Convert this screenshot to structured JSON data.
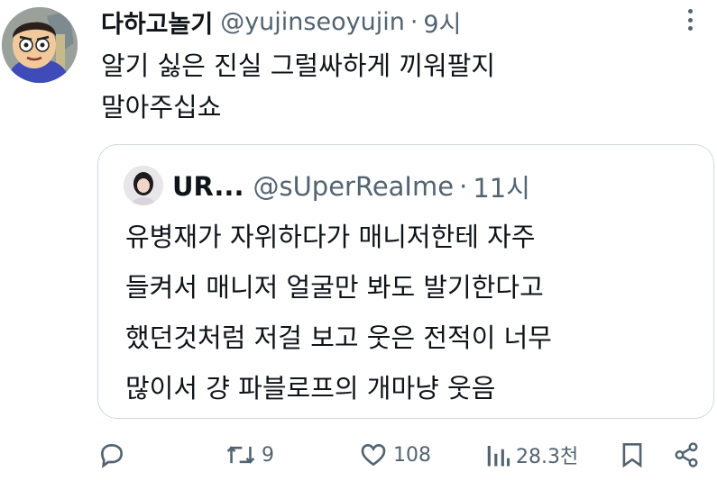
{
  "tweet": {
    "author_name": "다하고놀기",
    "handle": "@yujinseoyujin",
    "separator": "·",
    "time": "9시",
    "text_lines": [
      "알기 싫은 진실 그럴싸하게 끼워팔지",
      "말아주십쇼"
    ]
  },
  "quote": {
    "author_name": "UR...",
    "handle": "@sUperReaIme",
    "separator": "·",
    "time": "11시",
    "text_lines": [
      "유병재가 자위하다가 매니저한테 자주",
      "들켜서 매니저 얼굴만 봐도 발기한다고",
      "했던것처럼 저걸 보고 웃은 전적이 너무",
      "많이서 걍 파블로프의 개마냥 웃음"
    ]
  },
  "actions": {
    "reply_icon": "reply-icon",
    "retweet_icon": "retweet-icon",
    "retweet_count": "9",
    "like_icon": "heart-icon",
    "like_count": "108",
    "views_icon": "views-chart-icon",
    "views_count": "28.3천",
    "bookmark_icon": "bookmark-icon",
    "share_icon": "share-icon"
  },
  "colors": {
    "text_primary": "#0f1419",
    "text_secondary": "#536471",
    "quote_border": "#cfd9de"
  }
}
